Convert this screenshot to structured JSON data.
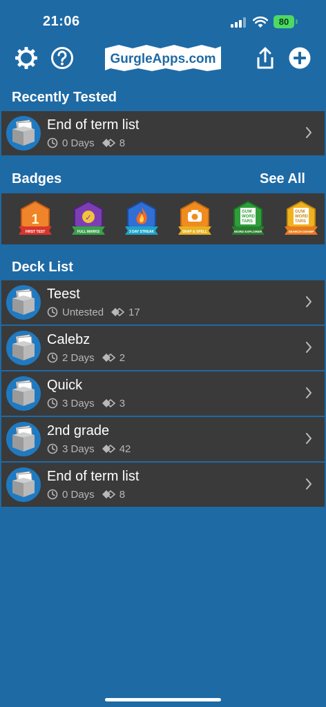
{
  "status": {
    "time": "21:06",
    "battery": "80"
  },
  "header": {
    "logo_text": "GurgleApps.com"
  },
  "recently_tested": {
    "title": "Recently Tested",
    "items": [
      {
        "name": "End of term list",
        "days": "0 Days",
        "cards": "8"
      }
    ]
  },
  "badges": {
    "title": "Badges",
    "see_all": "See All",
    "items": [
      {
        "label": "FIRST TEST",
        "color": "#f0842a",
        "ribbon": "#d9352b",
        "glyph": "1"
      },
      {
        "label": "FULL MARKS",
        "color": "#7b3fb3",
        "ribbon": "#3aa14b",
        "glyph": "✓"
      },
      {
        "label": "3 DAY STREAK",
        "color": "#2f6fd6",
        "ribbon": "#1ea3c9",
        "glyph": "🔥"
      },
      {
        "label": "SNAP & SPELL",
        "color": "#f08c1f",
        "ribbon": "#e8b121",
        "glyph": "📷"
      },
      {
        "label": "WORD EXPLORER",
        "color": "#2f9e3a",
        "ribbon": "#2a7f2f",
        "glyph": "W"
      },
      {
        "label": "SEARCH CHAMP",
        "color": "#f0b21f",
        "ribbon": "#e87a1d",
        "glyph": "W"
      }
    ]
  },
  "deck_list": {
    "title": "Deck List",
    "items": [
      {
        "name": "Teest",
        "days": "Untested",
        "cards": "17"
      },
      {
        "name": "Calebz",
        "days": "2 Days",
        "cards": "2"
      },
      {
        "name": "Quick",
        "days": "3 Days",
        "cards": "3"
      },
      {
        "name": "2nd grade",
        "days": "3 Days",
        "cards": "42"
      },
      {
        "name": "End of term list",
        "days": "0 Days",
        "cards": "8"
      }
    ]
  },
  "colors": {
    "background": "#1e6aa5",
    "row": "#3a3a3a",
    "meta_text": "#b8b8b8"
  },
  "icons": [
    "settings-gear-icon",
    "help-icon",
    "share-icon",
    "add-icon",
    "clock-icon",
    "cards-icon",
    "chevron-right-icon",
    "deck-box-icon"
  ]
}
